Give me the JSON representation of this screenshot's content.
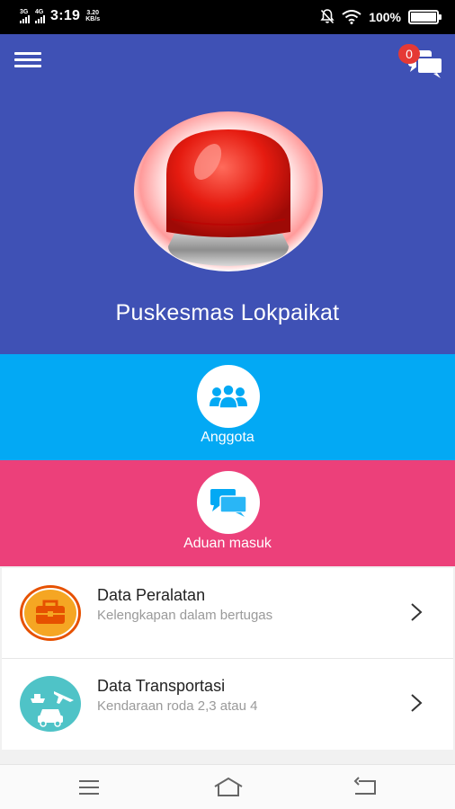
{
  "status_bar": {
    "signal1_label": "3G",
    "signal2_label": "4G",
    "time": "3:19",
    "net_speed_value": "3.20",
    "net_speed_unit": "KB/s",
    "battery_percent": "100%"
  },
  "header": {
    "notification_count": "0",
    "org_name": "Puskesmas Lokpaikat",
    "background_color": "#3f51b5"
  },
  "menu_tiles": [
    {
      "label": "Anggota",
      "icon": "group-icon",
      "color": "#03a9f4"
    },
    {
      "label": "Aduan masuk",
      "icon": "chat-bubbles-icon",
      "color": "#ec407a"
    }
  ],
  "data_list": [
    {
      "title": "Data Peralatan",
      "subtitle": "Kelengkapan dalam bertugas",
      "icon": "toolbox-icon"
    },
    {
      "title": "Data Transportasi",
      "subtitle": "Kendaraan roda 2,3 atau 4",
      "icon": "transport-icon"
    }
  ],
  "nav_bar": {
    "icons": [
      "recent-apps-icon",
      "home-icon",
      "back-icon"
    ]
  }
}
